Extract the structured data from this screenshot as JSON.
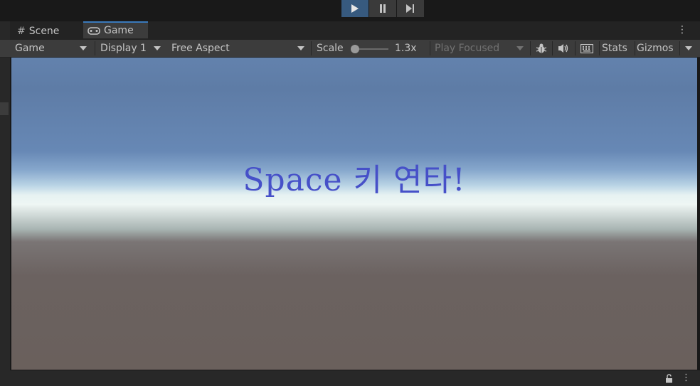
{
  "playbar": {
    "play_icon": "play-icon",
    "pause_icon": "pause-icon",
    "step_icon": "step-icon"
  },
  "tabs": [
    {
      "label": "Scene",
      "icon": "grid-icon"
    },
    {
      "label": "Game",
      "icon": "gamepad-icon"
    }
  ],
  "toolbar": {
    "game_dropdown": "Game",
    "display_dropdown": "Display 1",
    "aspect_dropdown": "Free Aspect",
    "scale_label": "Scale",
    "scale_value": "1.3x",
    "play_focused": "Play Focused",
    "stats_label": "Stats",
    "gizmos_label": "Gizmos"
  },
  "viewport": {
    "text": "Space 키 연타!"
  },
  "colors": {
    "accent": "#375a7f",
    "tab_highlight": "#3a79bb",
    "game_text": "#4650c8"
  }
}
